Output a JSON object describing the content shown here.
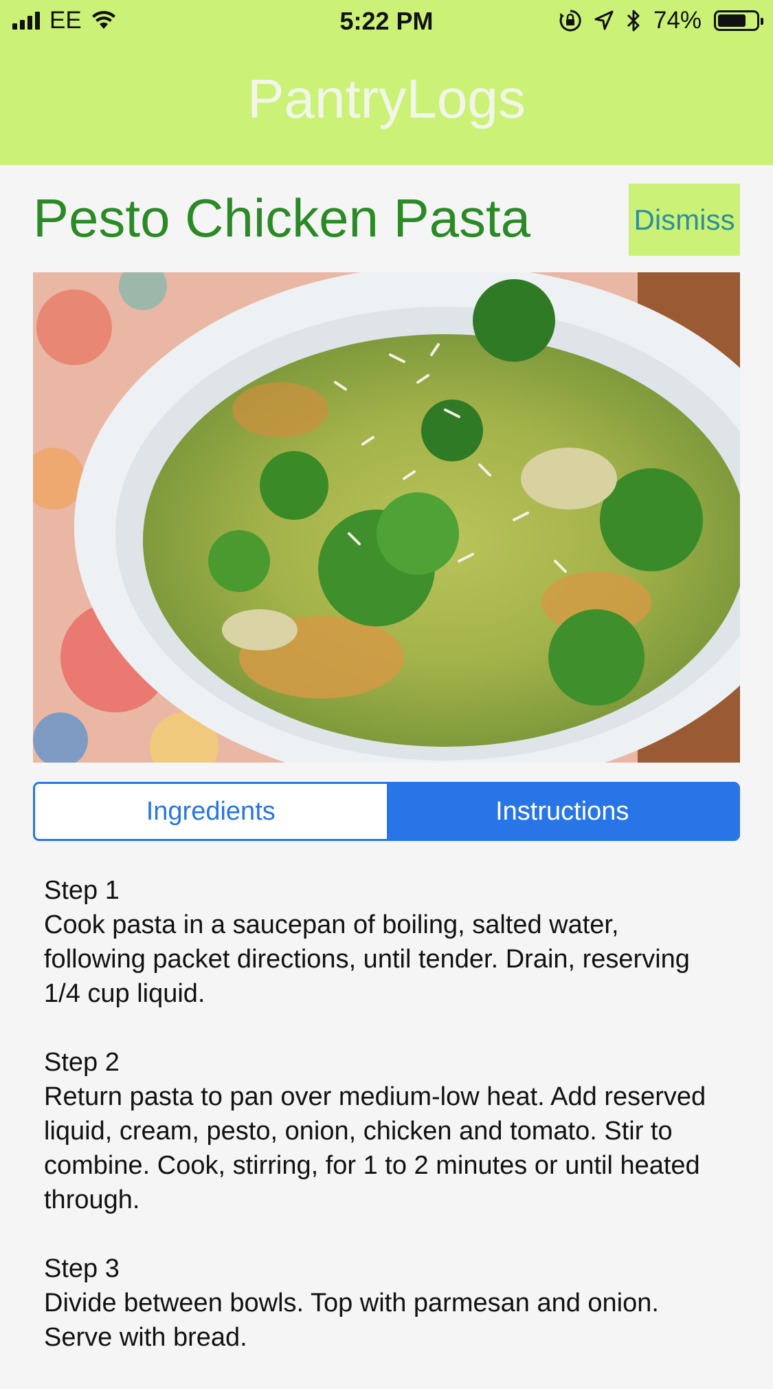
{
  "status_bar": {
    "carrier": "EE",
    "time": "5:22 PM",
    "battery_percent": "74%",
    "battery_level": 0.74,
    "icons": [
      "signal-icon",
      "wifi-icon",
      "orientation-lock-icon",
      "location-icon",
      "bluetooth-icon",
      "battery-icon"
    ]
  },
  "header": {
    "app_title": "PantryLogs",
    "background_color": "#cbf277"
  },
  "recipe": {
    "title": "Pesto Chicken Pasta",
    "dismiss_label": "Dismiss"
  },
  "tabs": {
    "items": [
      {
        "label": "Ingredients",
        "selected": false
      },
      {
        "label": "Instructions",
        "selected": true
      }
    ],
    "accent_color": "#2775e6"
  },
  "instructions": {
    "steps": [
      {
        "heading": "Step 1",
        "text": "Cook pasta in a saucepan of boiling, salted water, following packet directions, until tender. Drain, reserving 1/4 cup liquid."
      },
      {
        "heading": "Step 2",
        "text": "Return pasta to pan over medium-low heat. Add reserved liquid, cream, pesto, onion, chicken and tomato. Stir to combine. Cook, stirring, for 1 to 2 minutes or until heated through."
      },
      {
        "heading": "Step 3",
        "text": "Divide between bowls. Top with parmesan and onion. Serve with bread."
      }
    ]
  }
}
